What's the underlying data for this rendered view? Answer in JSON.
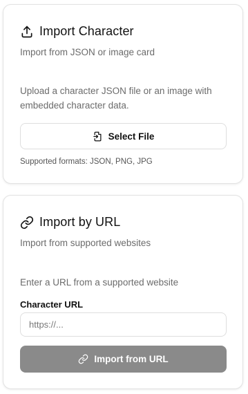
{
  "import_character": {
    "title": "Import Character",
    "subtitle": "Import from JSON or image card",
    "description": "Upload a character JSON file or an image with embedded character data.",
    "select_file_label": "Select File",
    "supported_formats": "Supported formats: JSON, PNG, JPG",
    "header_icon": "upload-icon",
    "button_icon": "file-import-icon"
  },
  "import_by_url": {
    "title": "Import by URL",
    "subtitle": "Import from supported websites",
    "description": "Enter a URL from a supported website",
    "field_label": "Character URL",
    "url_placeholder": "https://...",
    "url_value": "",
    "import_button_label": "Import from URL",
    "header_icon": "link-icon",
    "button_icon": "link-icon"
  },
  "colors": {
    "disabled_button": "#8a8a8a",
    "border": "#e2e2e2",
    "muted_text": "#6b6b6b"
  }
}
